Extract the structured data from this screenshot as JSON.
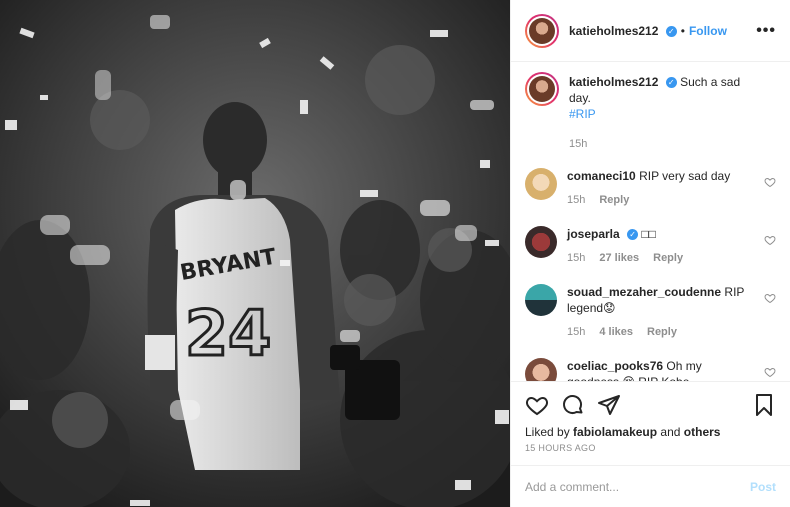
{
  "post": {
    "username": "katieholmes212",
    "follow_label": "Follow",
    "more_label": "•••",
    "caption_text": "Such a sad day.",
    "caption_hashtag": "#RIP",
    "caption_time": "15h"
  },
  "photo": {
    "jersey_name": "BRYANT",
    "jersey_number": "24"
  },
  "comments": [
    {
      "user": "comaneci10",
      "text": "RIP very sad day",
      "time": "15h",
      "likes": "",
      "reply": "Reply"
    },
    {
      "user": "joseparla",
      "text": "□□",
      "time": "15h",
      "likes": "27 likes",
      "reply": "Reply"
    },
    {
      "user": "souad_mezaher_coudenne",
      "text": "RIP legend😟",
      "time": "15h",
      "likes": "4 likes",
      "reply": "Reply"
    },
    {
      "user": "coeliac_pooks76",
      "text": "Oh my goodness 😔 RIP Kobe",
      "time": "",
      "likes": "",
      "reply": ""
    }
  ],
  "liked_by": {
    "prefix": "Liked by",
    "user": "fabiolamakeup",
    "and": "and",
    "others": "others"
  },
  "timestamp": "15 HOURS AGO",
  "add_comment": {
    "placeholder": "Add a comment...",
    "post_label": "Post"
  },
  "colors": {
    "link_blue": "#3897f0",
    "muted": "#8e8e8e",
    "post_disabled": "#b2dffc"
  }
}
